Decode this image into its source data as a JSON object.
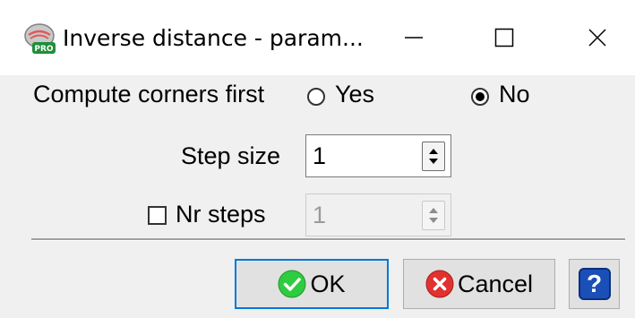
{
  "window": {
    "title": "Inverse distance - param...",
    "app_icon": "pro-app-icon",
    "minimize_icon": "minimize-icon",
    "maximize_icon": "maximize-icon",
    "close_icon": "close-icon"
  },
  "compute_corners": {
    "label": "Compute corners first",
    "options": [
      {
        "label": "Yes",
        "selected": false
      },
      {
        "label": "No",
        "selected": true
      }
    ]
  },
  "step_size": {
    "label": "Step size",
    "value": "1"
  },
  "nr_steps": {
    "label": "Nr steps",
    "checked": false,
    "value": "1",
    "enabled": false
  },
  "buttons": {
    "ok_label": "OK",
    "cancel_label": "Cancel",
    "help_glyph": "?"
  },
  "colors": {
    "accent": "#0078d7",
    "ok_green": "#2ecc40",
    "cancel_red": "#e0322e",
    "help_blue": "#1a4fb8"
  }
}
